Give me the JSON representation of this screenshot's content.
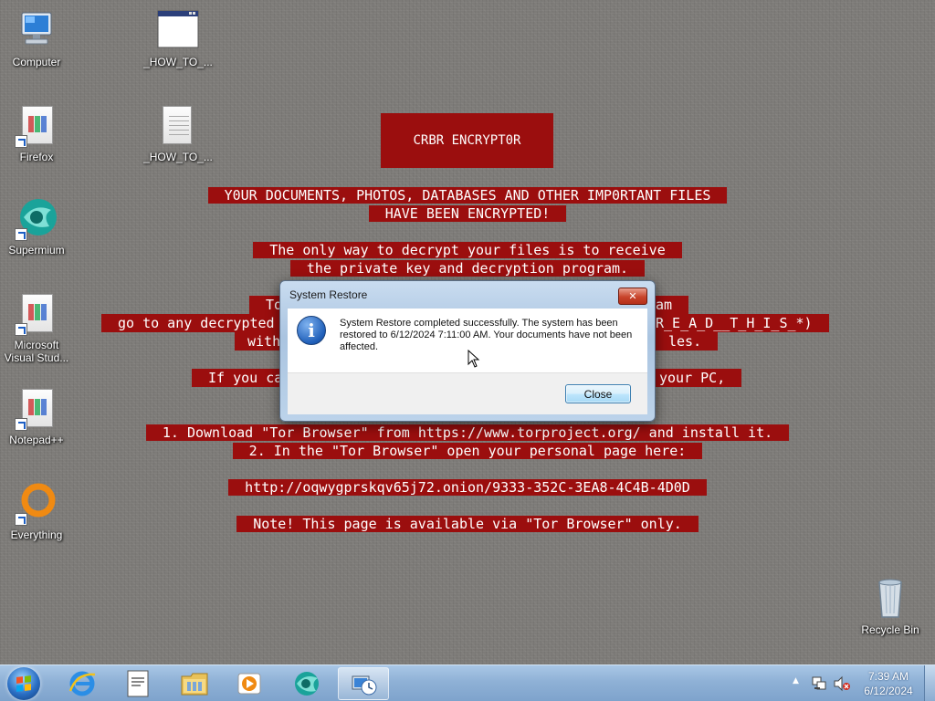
{
  "desktop": {
    "icons": [
      {
        "label": "Computer",
        "icon": "computer-icon"
      },
      {
        "label": "_HOW_TO_...",
        "icon": "window-file-icon"
      },
      {
        "label": "Firefox",
        "icon": "firefox-shortcut-icon"
      },
      {
        "label": "_HOW_TO_...",
        "icon": "text-file-icon"
      },
      {
        "label": "Supermium",
        "icon": "supermium-icon"
      },
      {
        "label": "Microsoft Visual Stud...",
        "icon": "visual-studio-shortcut-icon"
      },
      {
        "label": "Notepad++",
        "icon": "notepadpp-shortcut-icon"
      },
      {
        "label": "Everything",
        "icon": "everything-icon"
      },
      {
        "label": "Recycle Bin",
        "icon": "recycle-bin-icon"
      }
    ]
  },
  "ransom_note": {
    "title": "CRBR ENCRYPT0R",
    "line1": "Y0UR DOCUMENTS, PHOTOS, DATABASES AND OTHER IMP0RTANT FILES",
    "line2": "HAVE BEEN ENCRYPTED!",
    "line3": "The only way to decrypt your files is to receive",
    "line4": "the private key and decryption program.",
    "line5_left": "To",
    "line5_right": "am",
    "line6_left": "go to any decrypted",
    "line6_right": "R_E_A_D__T_H_I_S_*)",
    "line7_left": "with",
    "line7_right": "les.",
    "line8_left": "If you ca",
    "line8_right": "your PC,",
    "line9": "1. Download \"Tor Browser\" from https://www.torproject.org/ and install it.",
    "line10": "2. In the \"Tor Browser\" open your personal page here:",
    "line11": "http://oqwygprskqv65j72.onion/9333-352C-3EA8-4C4B-4D0D",
    "line12": "Note! This page is available via \"Tor Browser\" only."
  },
  "dialog": {
    "title": "System Restore",
    "close_glyph": "✕",
    "message": "System Restore completed successfully. The system has been restored to 6/12/2024 7:11:00 AM. Your documents have not been affected.",
    "info_glyph": "i",
    "close_button": "Close"
  },
  "taskbar": {
    "items": [
      "internet-explorer-icon",
      "document-icon",
      "file-explorer-icon",
      "media-player-icon",
      "supermium-icon",
      "system-restore-icon"
    ],
    "tray": {
      "show_hidden": "▲",
      "time": "7:39 AM",
      "date": "6/12/2024"
    }
  }
}
